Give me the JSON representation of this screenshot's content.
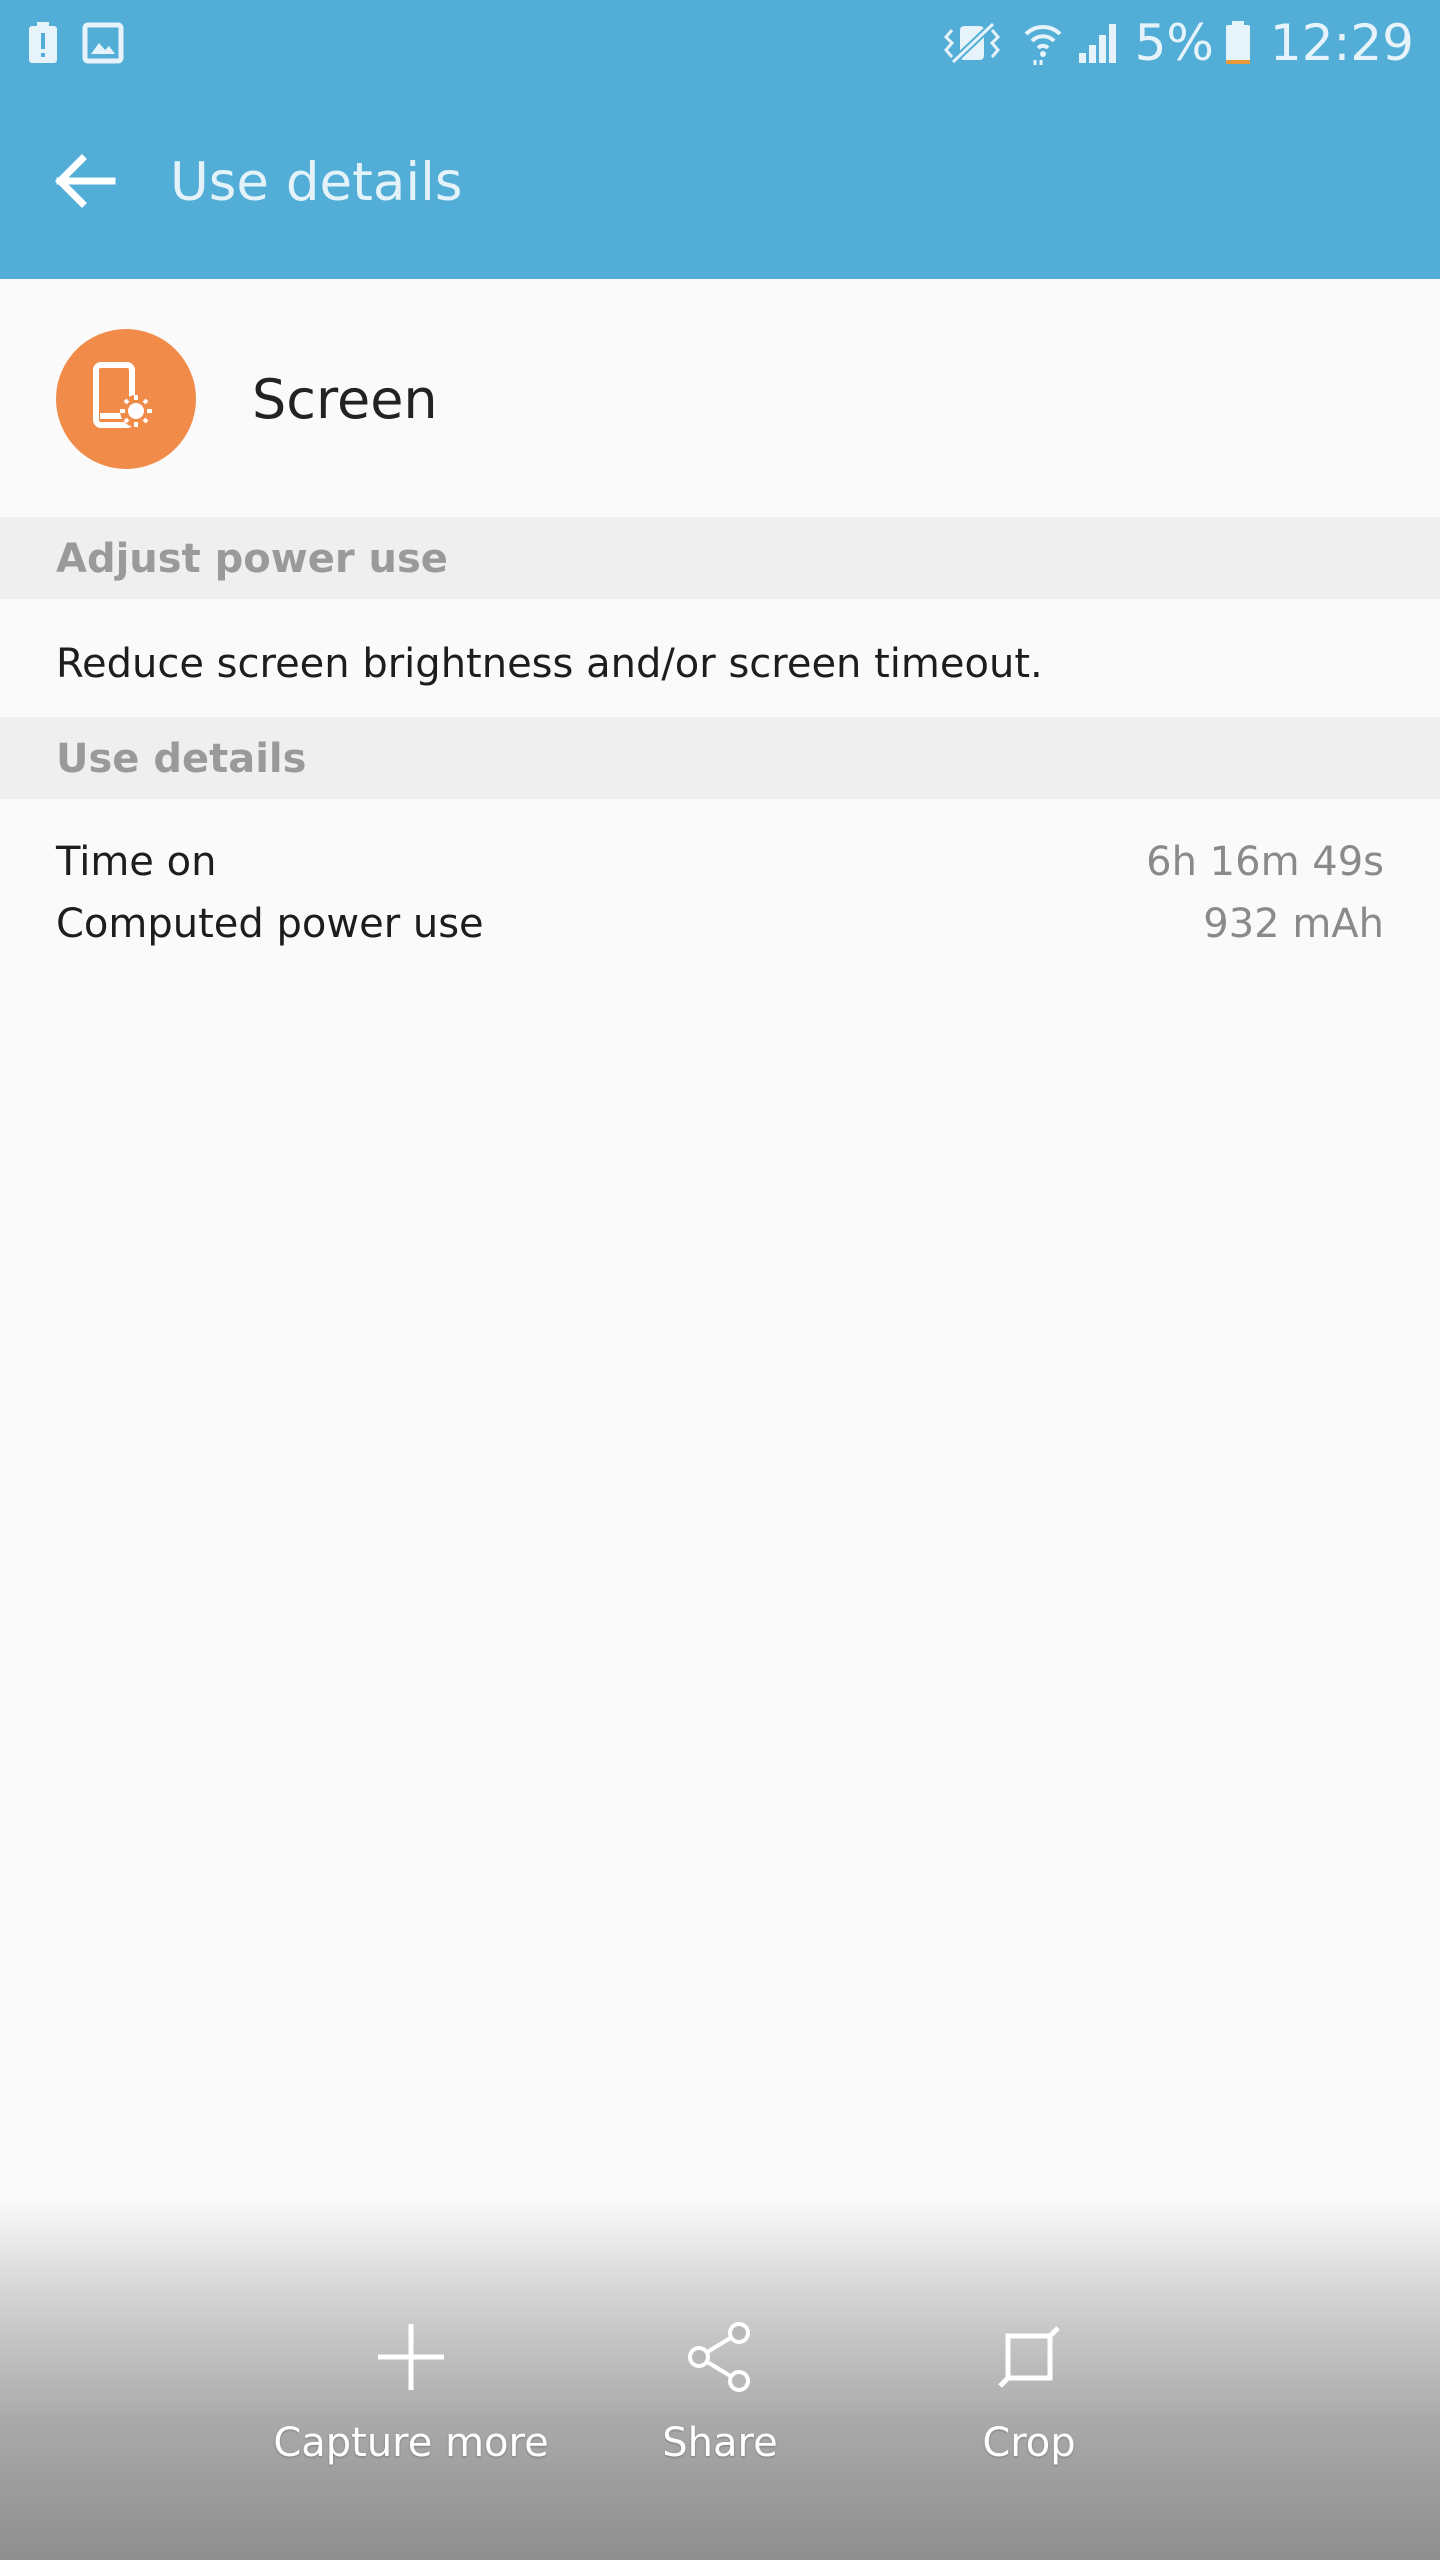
{
  "status_bar": {
    "battery_percent": "5%",
    "time": "12:29",
    "left_icons": [
      "battery-alert-icon",
      "image-icon"
    ],
    "right_icons": [
      "vibrate-mute-icon",
      "wifi-icon",
      "signal-icon",
      "battery-icon"
    ]
  },
  "app_bar": {
    "title": "Use details",
    "back_icon": "back-arrow-icon",
    "color": "#52aed6"
  },
  "app": {
    "name": "Screen",
    "icon": "screen-brightness-icon",
    "icon_color": "#f08b4a"
  },
  "sections": {
    "adjust": {
      "header": "Adjust power use",
      "tip": "Reduce screen brightness and/or screen timeout."
    },
    "details": {
      "header": "Use details",
      "rows": [
        {
          "label": "Time on",
          "value": "6h 16m 49s"
        },
        {
          "label": "Computed power use",
          "value": "932 mAh"
        }
      ]
    }
  },
  "capture_bar": {
    "buttons": [
      {
        "label": "Capture more",
        "icon": "plus-icon"
      },
      {
        "label": "Share",
        "icon": "share-icon"
      },
      {
        "label": "Crop",
        "icon": "crop-icon"
      }
    ]
  }
}
